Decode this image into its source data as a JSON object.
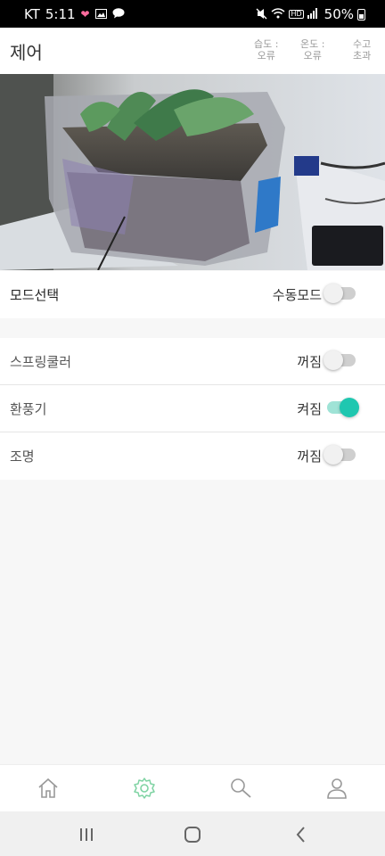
{
  "status_bar": {
    "carrier": "KT",
    "time": "5:11",
    "battery": "50%",
    "left_icons": [
      "heart-icon",
      "image-icon",
      "talk-icon"
    ],
    "right_icons": [
      "mute-icon",
      "wifi-icon",
      "hd-icon",
      "signal-icon",
      "battery-icon"
    ]
  },
  "header": {
    "title": "제어",
    "sensors": [
      {
        "label": "습도 :",
        "value": "오류"
      },
      {
        "label": "온도 :",
        "value": "오류"
      },
      {
        "label": "수고",
        "value": "초과"
      }
    ]
  },
  "mode": {
    "label": "모드선택",
    "state": "수동모드",
    "on": false
  },
  "devices": [
    {
      "label": "스프링쿨러",
      "state": "꺼짐",
      "on": false
    },
    {
      "label": "환풍기",
      "state": "켜짐",
      "on": true
    },
    {
      "label": "조명",
      "state": "꺼짐",
      "on": false
    }
  ],
  "bottom_nav": [
    {
      "icon": "home-icon",
      "active": false
    },
    {
      "icon": "gear-icon",
      "active": true
    },
    {
      "icon": "search-icon",
      "active": false
    },
    {
      "icon": "user-icon",
      "active": false
    }
  ],
  "colors": {
    "accent": "#1fc7b0",
    "accent_track": "#9fe3d6",
    "active_nav": "#7fd3a3",
    "inactive_nav": "#999999"
  }
}
